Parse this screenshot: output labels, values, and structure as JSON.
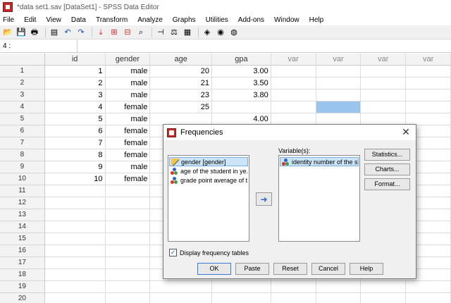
{
  "window": {
    "title": "*data set1.sav [DataSet1] - SPSS Data Editor"
  },
  "menu": [
    "File",
    "Edit",
    "View",
    "Data",
    "Transform",
    "Analyze",
    "Graphs",
    "Utilities",
    "Add-ons",
    "Window",
    "Help"
  ],
  "toolbar": {
    "icons": [
      "open-icon",
      "save-icon",
      "print-icon",
      "dialog-recall-icon",
      "undo-icon",
      "redo-icon",
      "goto-case-icon",
      "insert-case-icon",
      "insert-variable-icon",
      "find-icon",
      "split-file-icon",
      "weight-cases-icon",
      "select-cases-icon",
      "value-labels-icon",
      "use-sets-icon",
      "show-all-icon"
    ]
  },
  "cell_editor": {
    "reference": "4 :",
    "value": ""
  },
  "grid": {
    "columns": [
      "id",
      "gender",
      "age",
      "gpa",
      "var",
      "var",
      "var",
      "var"
    ],
    "rows": [
      {
        "n": "1",
        "id": "1",
        "gender": "male",
        "age": "20",
        "gpa": "3.00"
      },
      {
        "n": "2",
        "id": "2",
        "gender": "male",
        "age": "21",
        "gpa": "3.50"
      },
      {
        "n": "3",
        "id": "3",
        "gender": "male",
        "age": "23",
        "gpa": "3.80"
      },
      {
        "n": "4",
        "id": "4",
        "gender": "female",
        "age": "25",
        "gpa": ""
      },
      {
        "n": "5",
        "id": "5",
        "gender": "male",
        "age": "",
        "gpa": "4.00"
      },
      {
        "n": "6",
        "id": "6",
        "gender": "female",
        "age": "",
        "gpa": ""
      },
      {
        "n": "7",
        "id": "7",
        "gender": "female",
        "age": "",
        "gpa": ""
      },
      {
        "n": "8",
        "id": "8",
        "gender": "female",
        "age": "",
        "gpa": ""
      },
      {
        "n": "9",
        "id": "9",
        "gender": "male",
        "age": "",
        "gpa": ""
      },
      {
        "n": "10",
        "id": "10",
        "gender": "female",
        "age": "",
        "gpa": ""
      },
      {
        "n": "11",
        "id": "",
        "gender": "",
        "age": "",
        "gpa": ""
      },
      {
        "n": "12",
        "id": "",
        "gender": "",
        "age": "",
        "gpa": ""
      },
      {
        "n": "13",
        "id": "",
        "gender": "",
        "age": "",
        "gpa": ""
      },
      {
        "n": "14",
        "id": "",
        "gender": "",
        "age": "",
        "gpa": ""
      },
      {
        "n": "15",
        "id": "",
        "gender": "",
        "age": "",
        "gpa": ""
      },
      {
        "n": "16",
        "id": "",
        "gender": "",
        "age": "",
        "gpa": ""
      },
      {
        "n": "17",
        "id": "",
        "gender": "",
        "age": "",
        "gpa": ""
      },
      {
        "n": "18",
        "id": "",
        "gender": "",
        "age": "",
        "gpa": ""
      },
      {
        "n": "19",
        "id": "",
        "gender": "",
        "age": "",
        "gpa": ""
      },
      {
        "n": "20",
        "id": "",
        "gender": "",
        "age": "",
        "gpa": ""
      }
    ],
    "selected_row": 4,
    "selected_col_index": 5
  },
  "dialog": {
    "title": "Frequencies",
    "source_variables": [
      {
        "label": "gender [gender]",
        "icon": "pencil-icon",
        "active": true
      },
      {
        "label": "age of the student in ye...",
        "icon": "scale-variable-icon",
        "active": false
      },
      {
        "label": "grade point average of t...",
        "icon": "scale-variable-icon",
        "active": false
      }
    ],
    "variables_label": "Variable(s):",
    "target_variables": [
      {
        "label": "identity number of the st...",
        "icon": "scale-variable-icon"
      }
    ],
    "side_buttons": [
      "Statistics...",
      "Charts...",
      "Format..."
    ],
    "display_frequency_tables": {
      "label": "Display frequency tables",
      "checked": true
    },
    "buttons": [
      "OK",
      "Paste",
      "Reset",
      "Cancel",
      "Help"
    ]
  }
}
